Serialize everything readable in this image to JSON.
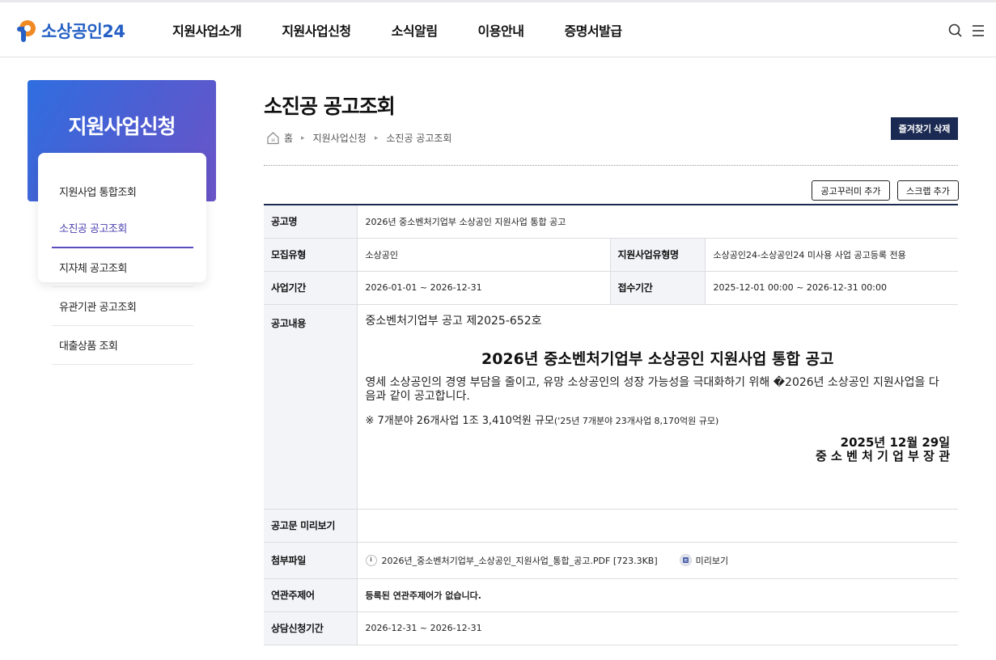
{
  "header": {
    "logo_text": "소상공인24",
    "nav": [
      "지원사업소개",
      "지원사업신청",
      "소식알림",
      "이용안내",
      "증명서발급"
    ],
    "icons": [
      "search-icon",
      "menu-icon"
    ]
  },
  "sidebar": {
    "title": "지원사업신청",
    "items": [
      {
        "label": "지원사업 통합조회"
      },
      {
        "label": "소진공 공고조회",
        "active": true
      },
      {
        "label": "지자체 공고조회"
      },
      {
        "label": "유관기관 공고조회"
      },
      {
        "label": "대출상품 조회"
      }
    ]
  },
  "page": {
    "title": "소진공 공고조회",
    "breadcrumb": [
      "홈",
      "지원사업신청",
      "소진공 공고조회"
    ],
    "fav_button": "즐겨찾기 삭제",
    "bookmark_button": "공고꾸러미 추가",
    "scrap_button": "스크랩 추가"
  },
  "info": {
    "notice_name_label": "공고명",
    "notice_name": "2026년 중소벤처기업부 소상공인 지원사업 통합 공고",
    "recruit_type_label": "모집유형",
    "recruit_type": "소상공인",
    "support_type_label": "지원사업유형명",
    "support_type": "소상공인24-소상공인24 미사용 사업 공고등록 전용",
    "period_label": "사업기간",
    "period": "2026-01-01 ~ 2026-12-31",
    "reception_label": "접수기간",
    "reception": "2025-12-01 00:00 ~ 2026-12-31 00:00",
    "content_label": "공고내용",
    "content": {
      "number": "중소벤처기업부 공고 제2025-652호",
      "title": "2026년 중소벤처기업부 소상공인 지원사업 통합 공고",
      "body": "영세 소상공인의 경영 부담을 줄이고, 유망 소상공인의 성장 가능성을 극대화하기 위해 �2026년 소상공인 지원사업을 다음과 같이 공고합니다.",
      "note_main": "※  7개분야 26개사업 1조 3,410억원 규모",
      "note_sub": "('25년 7개분야 23개사업 8,170억원 규모)",
      "date": "2025년 12월 29일",
      "signer": "중 소 벤 처 기 업 부 장 관"
    },
    "preview_label": "공고문 미리보기",
    "attachment_label": "첨부파일",
    "attachment_name": "2026년_중소벤처기업부_소상공인_지원사업_통합_공고.PDF [723.3KB]",
    "attachment_preview": "미리보기",
    "related_label": "연관주제어",
    "related": "등록된 연관주제어가 없습니다.",
    "consult_label": "상담신청기간",
    "consult": "2026-12-31 ~ 2026-12-31"
  },
  "colors": {
    "brand_blue": "#2660c4",
    "brand_orange": "#f08a24",
    "navy": "#1b2a52",
    "active_purple": "#4a3fb0"
  }
}
